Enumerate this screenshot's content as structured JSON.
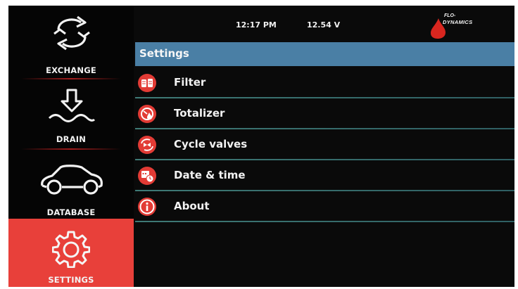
{
  "topbar": {
    "time": "12:17 PM",
    "voltage": "12.54 V"
  },
  "brand": {
    "line1": "FLO-",
    "line2": "DYNAMICS",
    "drop_color": "#d8261f"
  },
  "sidebar": {
    "items": [
      {
        "label": "EXCHANGE",
        "icon": "exchange-arrows-icon",
        "active": false
      },
      {
        "label": "DRAIN",
        "icon": "drain-arrow-icon",
        "active": false
      },
      {
        "label": "DATABASE",
        "icon": "car-icon",
        "active": false
      },
      {
        "label": "SETTINGS",
        "icon": "gear-icon",
        "active": true
      }
    ]
  },
  "settings": {
    "title": "Settings",
    "items": [
      {
        "label": "Filter",
        "icon": "filter-icon"
      },
      {
        "label": "Totalizer",
        "icon": "totalizer-gauge-icon"
      },
      {
        "label": "Cycle valves",
        "icon": "cycle-valves-icon"
      },
      {
        "label": "Date & time",
        "icon": "calendar-clock-icon"
      },
      {
        "label": "About",
        "icon": "info-icon"
      }
    ]
  },
  "colors": {
    "accent": "#e23b35",
    "header": "#4a7fa5",
    "background": "#0a0a0a"
  }
}
